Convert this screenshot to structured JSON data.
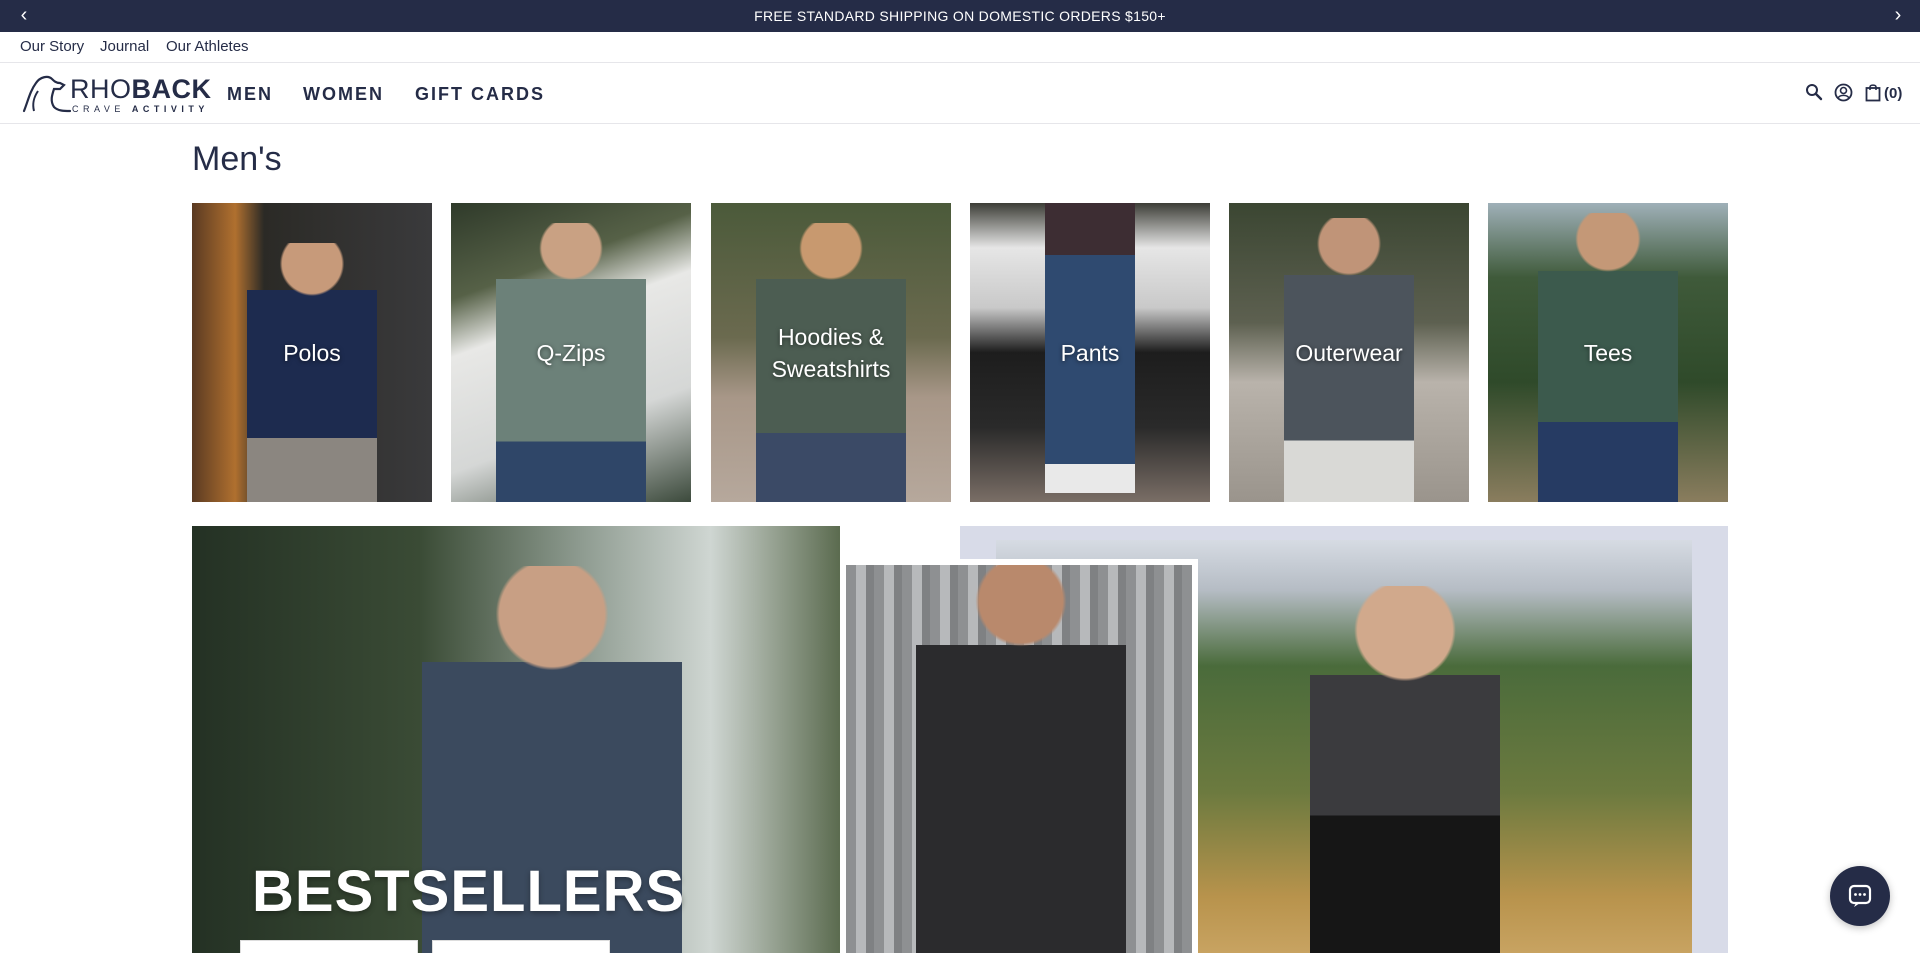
{
  "announcement": {
    "text": "FREE STANDARD SHIPPING ON DOMESTIC ORDERS $150+",
    "prev_icon": "chevron-left-icon",
    "next_icon": "chevron-right-icon"
  },
  "utility_nav": [
    {
      "label": "Our Story"
    },
    {
      "label": "Journal"
    },
    {
      "label": "Our Athletes"
    }
  ],
  "brand": {
    "name_light": "RHO",
    "name_bold": "BACK",
    "tagline_light": "CRAVE",
    "tagline_bold": "ACTIVITY"
  },
  "main_nav": [
    {
      "label": "MEN"
    },
    {
      "label": "WOMEN"
    },
    {
      "label": "GIFT CARDS"
    }
  ],
  "header_icons": {
    "search": "search-icon",
    "account": "account-icon",
    "cart": "bag-icon",
    "cart_count": "(0)"
  },
  "page": {
    "title": "Men's"
  },
  "categories": [
    {
      "label": "Polos"
    },
    {
      "label": "Q-Zips"
    },
    {
      "label": "Hoodies & Sweatshirts"
    },
    {
      "label": "Pants"
    },
    {
      "label": "Outerwear"
    },
    {
      "label": "Tees"
    }
  ],
  "promo": {
    "headline": "BESTSELLERS"
  },
  "colors": {
    "brand_navy": "#252c47",
    "background": "#ffffff"
  }
}
